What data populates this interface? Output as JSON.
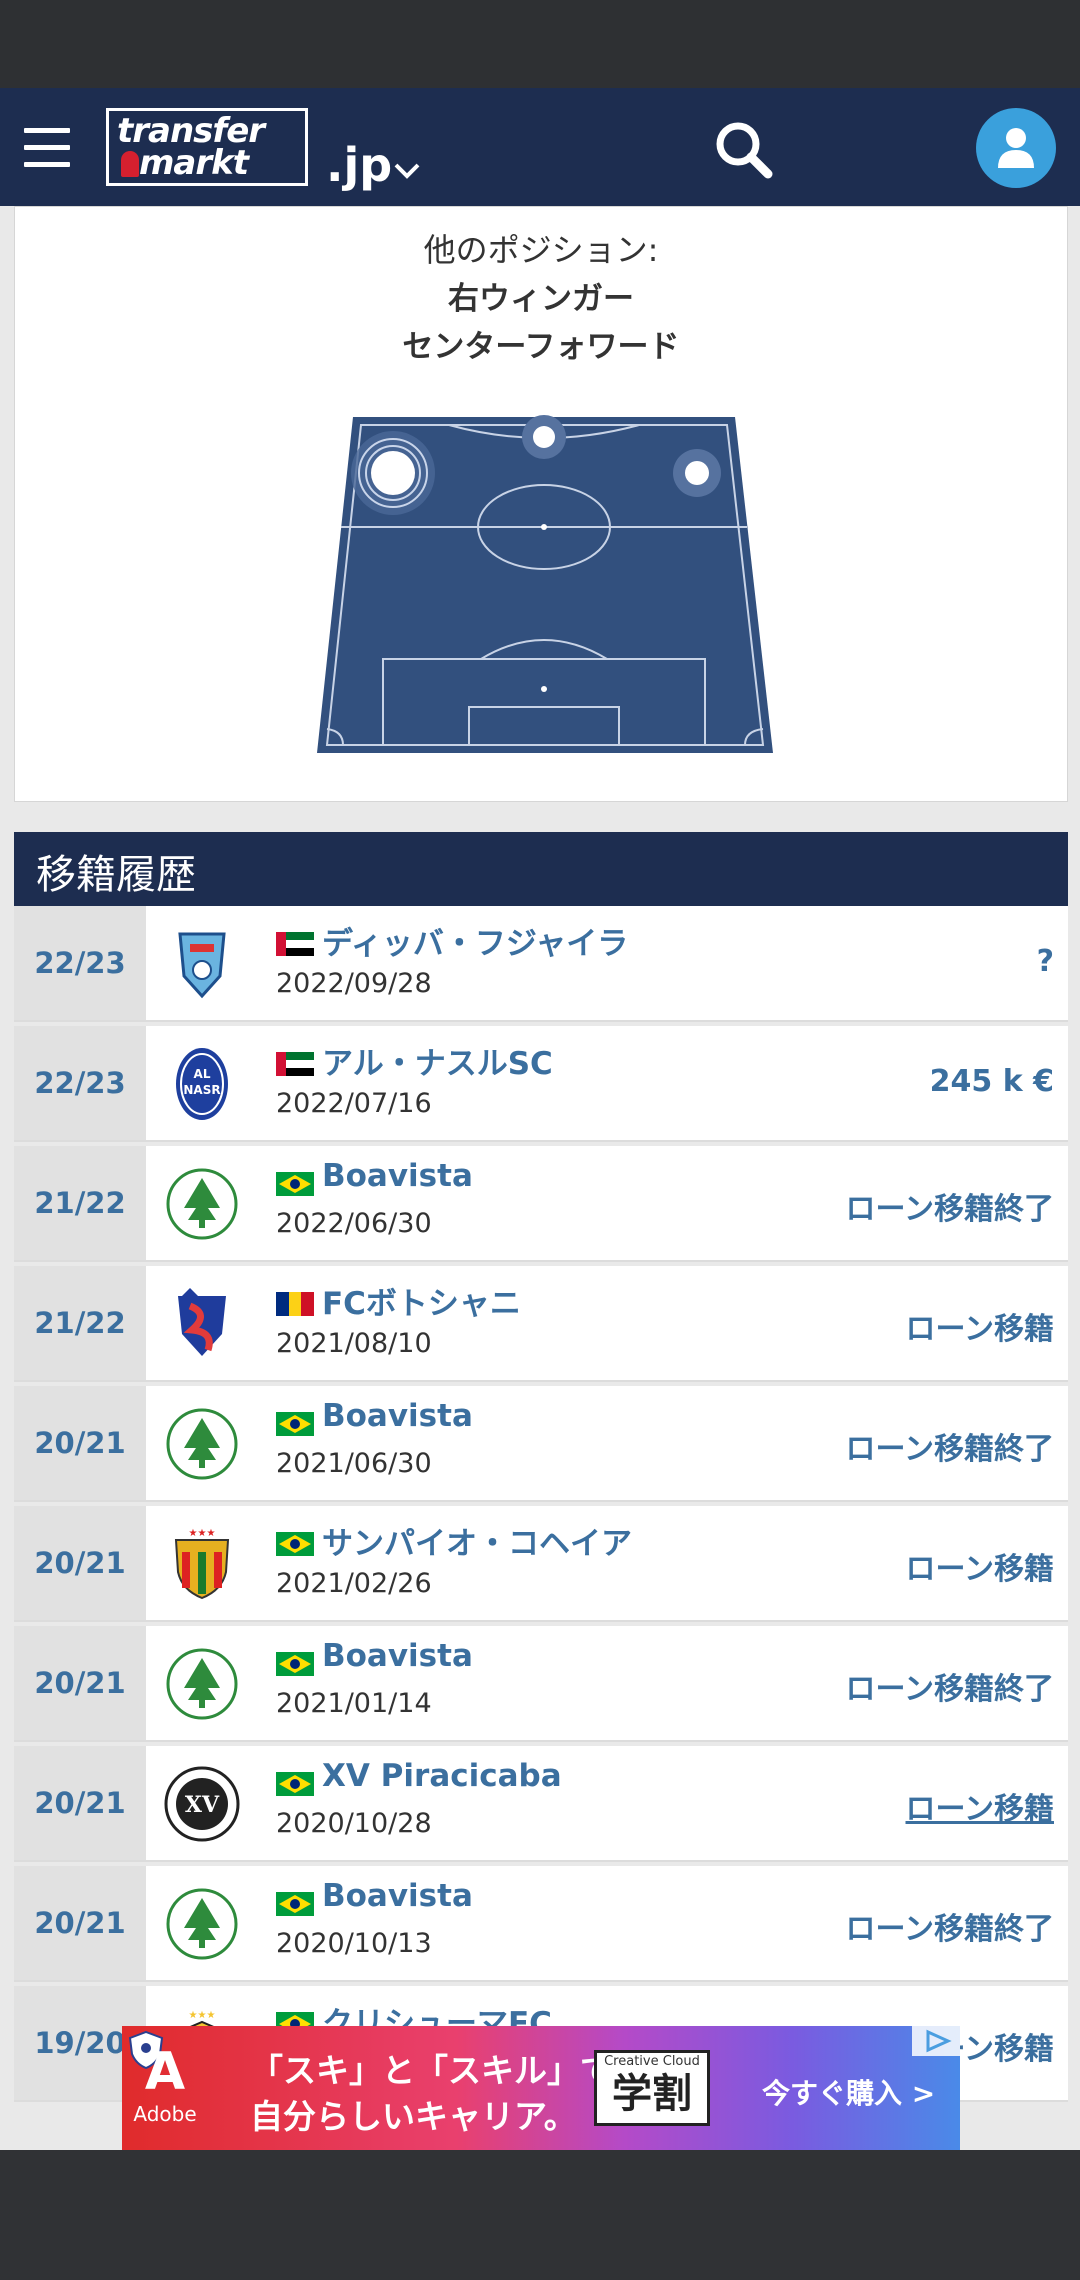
{
  "header": {
    "logo_line1": "transfer",
    "logo_line2": "markt",
    "domain_label": ".jp"
  },
  "positions": {
    "label": "他のポジション:",
    "items": [
      "右ウィンガー",
      "センターフォワード"
    ]
  },
  "transfer_history": {
    "title": "移籍履歴",
    "rows": [
      {
        "season": "22/23",
        "club": "ディッバ・フジャイラ",
        "country": "UAE",
        "date": "2022/09/28",
        "fee": "?"
      },
      {
        "season": "22/23",
        "club": "アル・ナスルSC",
        "country": "UAE",
        "date": "2022/07/16",
        "fee": "245 k €"
      },
      {
        "season": "21/22",
        "club": "Boavista",
        "country": "Brazil",
        "date": "2022/06/30",
        "fee": "ローン移籍終了"
      },
      {
        "season": "21/22",
        "club": "FCボトシャニ",
        "country": "Romania",
        "date": "2021/08/10",
        "fee": "ローン移籍"
      },
      {
        "season": "20/21",
        "club": "Boavista",
        "country": "Brazil",
        "date": "2021/06/30",
        "fee": "ローン移籍終了"
      },
      {
        "season": "20/21",
        "club": "サンパイオ・コヘイア",
        "country": "Brazil",
        "date": "2021/02/26",
        "fee": "ローン移籍"
      },
      {
        "season": "20/21",
        "club": "Boavista",
        "country": "Brazil",
        "date": "2021/01/14",
        "fee": "ローン移籍終了"
      },
      {
        "season": "20/21",
        "club": "XV Piracicaba",
        "country": "Brazil",
        "date": "2020/10/28",
        "fee": "ローン移籍"
      },
      {
        "season": "20/21",
        "club": "Boavista",
        "country": "Brazil",
        "date": "2020/10/13",
        "fee": "ローン移籍終了"
      },
      {
        "season": "19/20",
        "club": "クリシューマEC",
        "country": "Brazil",
        "date": "",
        "fee": "ローン移籍"
      }
    ]
  },
  "ad": {
    "brand": "Adobe",
    "line1": "「スキ」と「スキル」で",
    "line2": "自分らしいキャリア。",
    "badge_small": "Creative Cloud",
    "badge_big": "学割",
    "cta": "今すぐ購入 >"
  },
  "colors": {
    "nav": "#1d2d50",
    "link": "#3b6f9f",
    "accent_user": "#3aa0dc"
  }
}
